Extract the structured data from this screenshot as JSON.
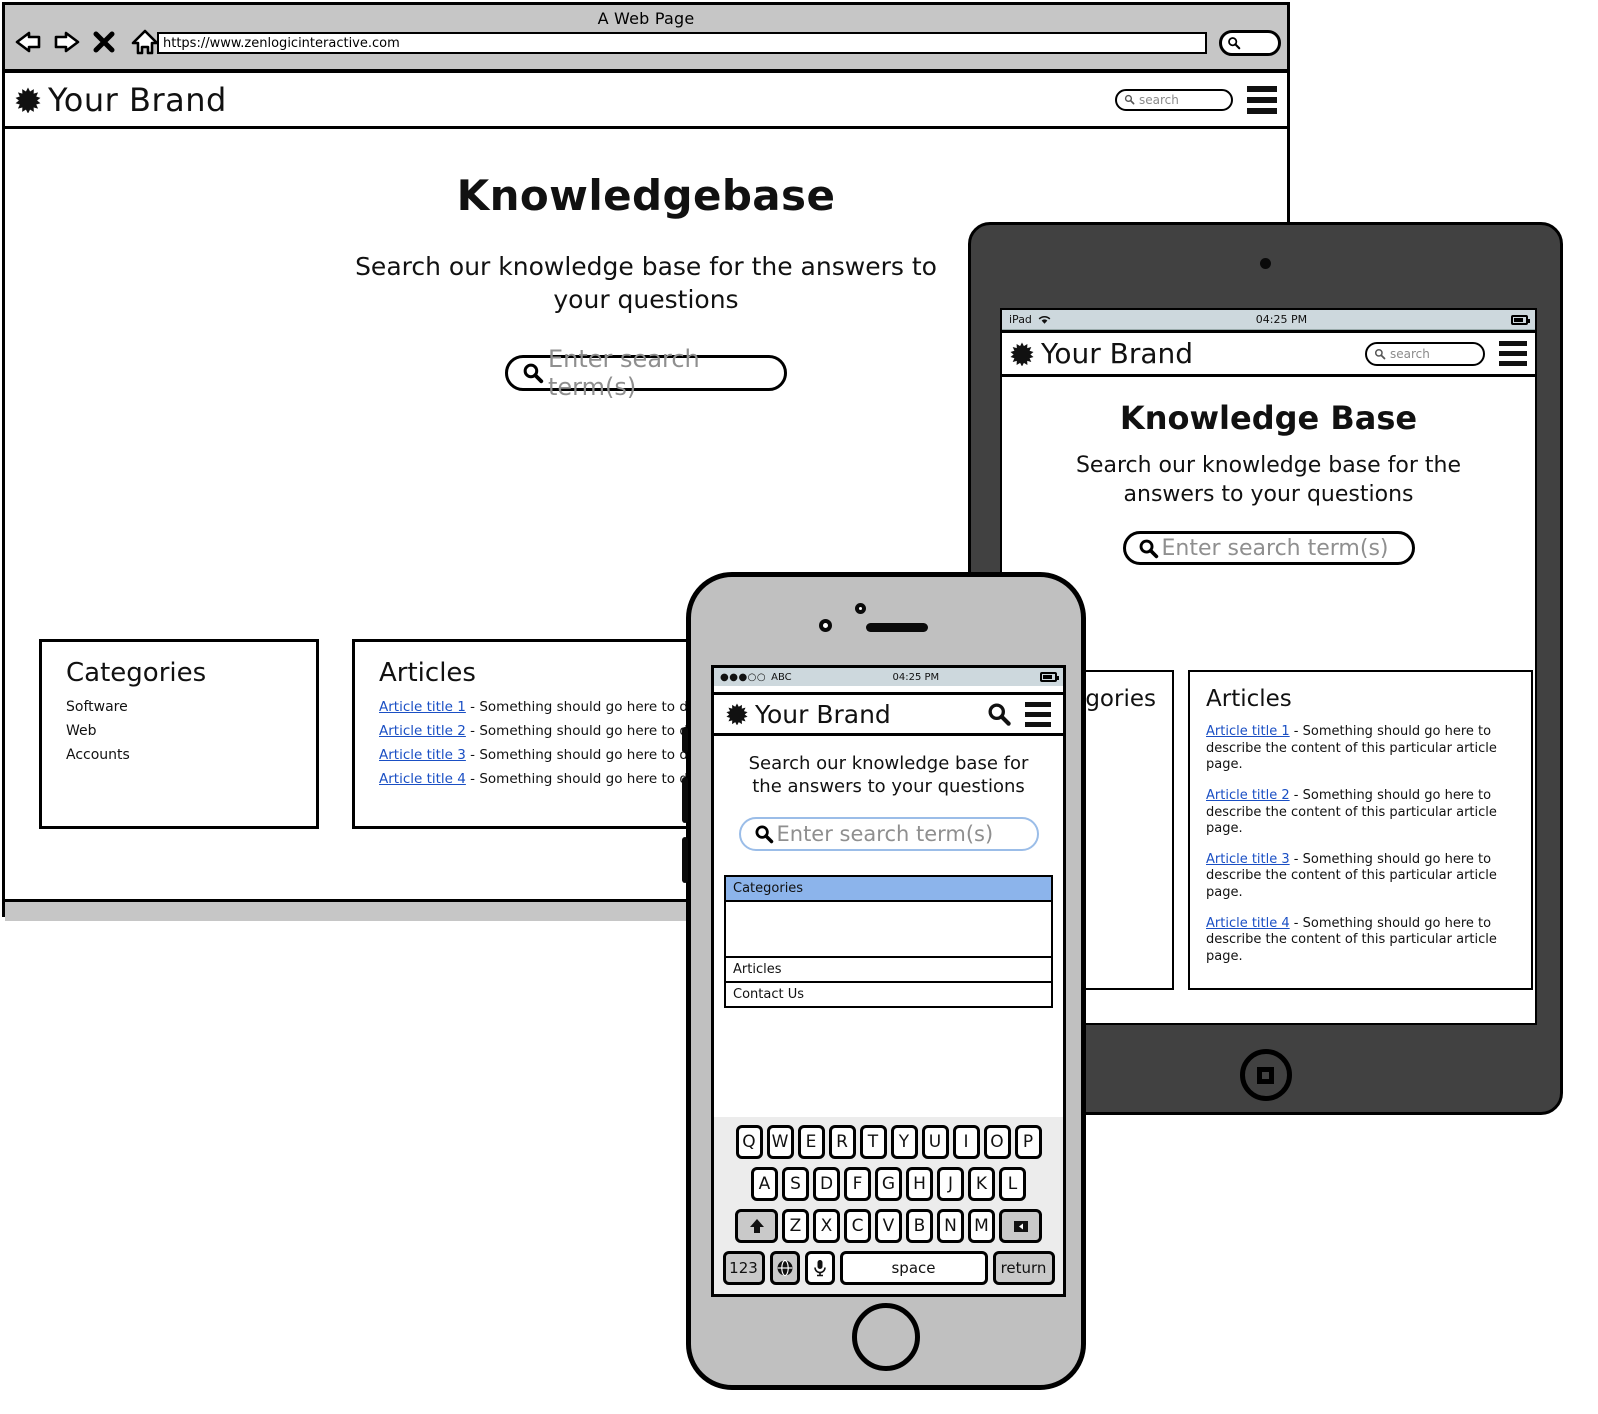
{
  "browser": {
    "window_title": "A Web Page",
    "url": "https://www.zenlogicinteractive.com",
    "nav_icons": [
      "back-arrow-icon",
      "forward-arrow-icon",
      "close-x-icon",
      "home-icon"
    ],
    "search_icon": "magnifier-icon"
  },
  "desktop": {
    "brand": "Your Brand",
    "header_search_placeholder": "search",
    "menu_icon": "hamburger-menu-icon",
    "page_title": "Knowledgebase",
    "subtitle": "Search our knowledge base for the answers to your questions",
    "search_placeholder": "Enter search term(s)",
    "categories": {
      "heading": "Categories",
      "items": [
        "Software",
        "Web",
        "Accounts"
      ]
    },
    "articles": {
      "heading": "Articles",
      "items": [
        {
          "title": "Article title 1",
          "separator": " - ",
          "desc": "Something should go here to describe t"
        },
        {
          "title": "Article title 2",
          "separator": " - ",
          "desc": "Something should go here to describe "
        },
        {
          "title": "Article title 3",
          "separator": " - ",
          "desc": "Something should go here to describe "
        },
        {
          "title": "Article title 4",
          "separator": " - ",
          "desc": "Something should go here to describe "
        }
      ]
    }
  },
  "tablet": {
    "status": {
      "carrier": "iPad",
      "wifi_icon": "wifi-icon",
      "time": "04:25 PM",
      "battery_icon": "battery-icon"
    },
    "brand": "Your Brand",
    "header_search_placeholder": "search",
    "menu_icon": "hamburger-menu-icon",
    "page_title": "Knowledge Base",
    "subtitle": "Search our knowledge base for the answers to your questions",
    "search_placeholder": "Enter search term(s)",
    "categories": {
      "heading": "Categories"
    },
    "articles": {
      "heading": "Articles",
      "items": [
        {
          "title": "Article title 1",
          "separator": " - ",
          "desc": "Something should go here to describe the content of this particular article page."
        },
        {
          "title": "Article title 2",
          "separator": " - ",
          "desc": "Something should go here to describe the content of this particular article page."
        },
        {
          "title": "Article title 3",
          "separator": " - ",
          "desc": "Something should go here to describe the content of this particular article page."
        },
        {
          "title": "Article title 4",
          "separator": " - ",
          "desc": "Something should go here to describe the content of this particular article page."
        }
      ]
    },
    "home_button_icon": "home-square-icon"
  },
  "phone": {
    "status": {
      "signal": "●●●○○",
      "carrier": "ABC",
      "time": "04:25 PM",
      "battery_icon": "battery-icon"
    },
    "brand": "Your Brand",
    "search_icon": "magnifier-icon",
    "menu_icon": "hamburger-menu-icon",
    "subtitle": "Search our knowledge base for the answers to your questions",
    "search_placeholder": "Enter search term(s)",
    "list": [
      {
        "label": "Categories",
        "selected": true
      },
      {
        "label": "",
        "blank": true
      },
      {
        "label": "Articles",
        "selected": false
      },
      {
        "label": "Contact Us",
        "selected": false
      }
    ],
    "keyboard": {
      "row1": [
        "Q",
        "W",
        "E",
        "R",
        "T",
        "Y",
        "U",
        "I",
        "O",
        "P"
      ],
      "row2": [
        "A",
        "S",
        "D",
        "F",
        "G",
        "H",
        "J",
        "K",
        "L"
      ],
      "row3_letters": [
        "Z",
        "X",
        "C",
        "V",
        "B",
        "N",
        "M"
      ],
      "shift_icon": "shift-arrow-icon",
      "delete_icon": "backspace-icon",
      "numbers_key": "123",
      "globe_icon": "globe-icon",
      "mic_icon": "microphone-icon",
      "space_key": "space",
      "return_key": "return"
    },
    "home_button_icon": "home-circle-icon"
  },
  "colors": {
    "link": "#1a4fc4",
    "selected_row": "#8cb4eb",
    "chrome_gray": "#c6c6c6",
    "device_dark": "#414141",
    "phone_body": "#c0c0c0",
    "status_bar": "#cdd8dd",
    "keyboard_bg": "#ececec"
  }
}
